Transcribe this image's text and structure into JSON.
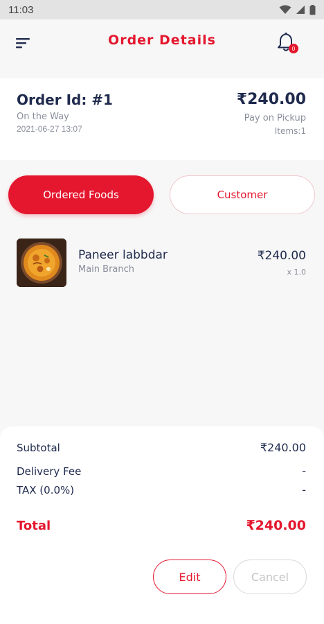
{
  "status_bar": {
    "time": "11:03"
  },
  "header": {
    "title": "Order Details",
    "notification_count": "0"
  },
  "order": {
    "id_label": "Order Id: #1",
    "status": "On the Way",
    "datetime": "2021-06-27 13:07",
    "amount": "₹240.00",
    "payment_method": "Pay on Pickup",
    "items_count": "Items:1"
  },
  "tabs": [
    {
      "label": "Ordered Foods",
      "active": true
    },
    {
      "label": "Customer",
      "active": false
    }
  ],
  "items": [
    {
      "name": "Paneer labbdar",
      "branch": "Main Branch",
      "price": "₹240.00",
      "quantity": "x 1.0"
    }
  ],
  "summary": {
    "subtotal_label": "Subtotal",
    "subtotal_value": "₹240.00",
    "delivery_label": "Delivery Fee",
    "delivery_value": "-",
    "tax_label": "TAX (0.0%)",
    "tax_value": "-",
    "total_label": "Total",
    "total_value": "₹240.00"
  },
  "actions": {
    "edit_label": "Edit",
    "cancel_label": "Cancel"
  },
  "colors": {
    "accent": "#e4172e",
    "text_primary": "#1f2a4d",
    "text_secondary": "#8a8f9c"
  },
  "icons": {
    "menu": "menu-icon",
    "notification": "bell-icon",
    "wifi": "wifi-icon",
    "signal": "signal-icon",
    "battery": "battery-icon"
  }
}
